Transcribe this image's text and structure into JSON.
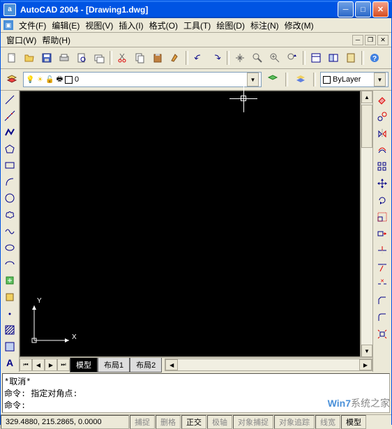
{
  "title": "AutoCAD 2004 - [Drawing1.dwg]",
  "menu": {
    "file": "文件(F)",
    "edit": "编辑(E)",
    "view": "视图(V)",
    "insert": "插入(I)",
    "format": "格式(O)",
    "tools": "工具(T)",
    "draw": "绘图(D)",
    "dimension": "标注(N)",
    "modify": "修改(M)",
    "window": "窗口(W)",
    "help": "帮助(H)"
  },
  "layer": {
    "current": "0",
    "bylayer": "ByLayer"
  },
  "tabs": {
    "model": "模型",
    "layout1": "布局1",
    "layout2": "布局2"
  },
  "ucs": {
    "x": "X",
    "y": "Y"
  },
  "command": {
    "line1": "*取消*",
    "line2": "命令: 指定对角点:",
    "line3": "命令:"
  },
  "status": {
    "coords": "329.4880, 215.2865, 0.0000",
    "snap": "捕捉",
    "grid": "删格",
    "ortho": "正交",
    "polar": "极轴",
    "osnap": "对象捕捉",
    "otrack": "对象追踪",
    "lwt": "线宽",
    "model": "模型"
  },
  "watermark": {
    "a": "Win7",
    "b": "系统之家"
  }
}
